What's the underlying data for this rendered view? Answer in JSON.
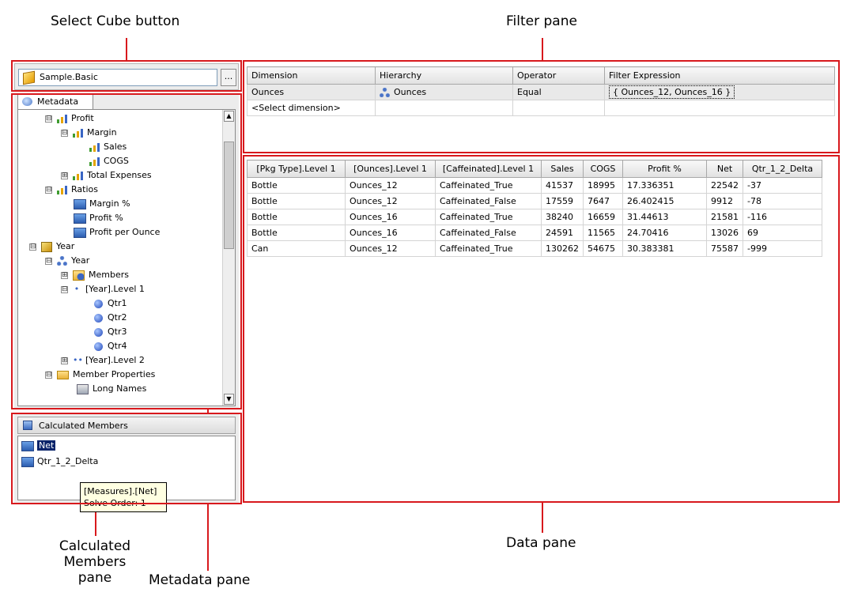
{
  "callouts": {
    "select_cube": "Select Cube button",
    "filter_pane": "Filter pane",
    "calculated_members_line1": "Calculated",
    "calculated_members_line2": "Members pane",
    "metadata_pane": "Metadata pane",
    "data_pane": "Data pane"
  },
  "cube": {
    "value": "Sample.Basic",
    "browse_label": "..."
  },
  "metadata": {
    "tab_label": "Metadata",
    "tree": [
      {
        "label": "Profit",
        "exp": "⊟"
      },
      {
        "label": "Margin",
        "exp": "⊟"
      },
      {
        "label": "Sales"
      },
      {
        "label": "COGS"
      },
      {
        "label": "Total Expenses",
        "exp": "⊞"
      },
      {
        "label": "Ratios",
        "exp": "⊟"
      },
      {
        "label": "Margin %"
      },
      {
        "label": "Profit %"
      },
      {
        "label": "Profit per Ounce"
      },
      {
        "label": "Year",
        "exp": "⊟"
      },
      {
        "label": "Year",
        "exp": "⊟"
      },
      {
        "label": "Members",
        "exp": "⊞"
      },
      {
        "label": "[Year].Level 1",
        "exp": "⊟"
      },
      {
        "label": "Qtr1"
      },
      {
        "label": "Qtr2"
      },
      {
        "label": "Qtr3"
      },
      {
        "label": "Qtr4"
      },
      {
        "label": "[Year].Level 2",
        "exp": "⊞"
      },
      {
        "label": "Member Properties",
        "exp": "⊟"
      },
      {
        "label": "Long Names"
      }
    ]
  },
  "calculated_members": {
    "title": "Calculated Members",
    "items": [
      "Net",
      "Qtr_1_2_Delta"
    ],
    "tooltip_line1": "[Measures].[Net]",
    "tooltip_line2": "Solve Order: 1"
  },
  "filter": {
    "headers": [
      "Dimension",
      "Hierarchy",
      "Operator",
      "Filter Expression"
    ],
    "rows": [
      [
        "Ounces",
        "Ounces",
        "Equal",
        "{ Ounces_12, Ounces_16 }"
      ],
      [
        "<Select dimension>",
        "",
        "",
        ""
      ]
    ]
  },
  "data": {
    "headers": [
      "[Pkg Type].Level 1",
      "[Ounces].Level 1",
      "[Caffeinated].Level 1",
      "Sales",
      "COGS",
      "Profit %",
      "Net",
      "Qtr_1_2_Delta"
    ],
    "rows": [
      [
        "Bottle",
        "Ounces_12",
        "Caffeinated_True",
        "41537",
        "18995",
        "17.336351",
        "22542",
        "-37"
      ],
      [
        "Bottle",
        "Ounces_12",
        "Caffeinated_False",
        "17559",
        "7647",
        "26.402415",
        "9912",
        "-78"
      ],
      [
        "Bottle",
        "Ounces_16",
        "Caffeinated_True",
        "38240",
        "16659",
        "31.44613",
        "21581",
        "-116"
      ],
      [
        "Bottle",
        "Ounces_16",
        "Caffeinated_False",
        "24591",
        "11565",
        "24.70416",
        "13026",
        "69"
      ],
      [
        "Can",
        "Ounces_12",
        "Caffeinated_True",
        "130262",
        "54675",
        "30.383381",
        "75587",
        "-999"
      ]
    ]
  },
  "colors": {
    "callout_red": "#d8191d",
    "selection": "#0a246a",
    "tooltip_bg": "#ffffe1"
  }
}
